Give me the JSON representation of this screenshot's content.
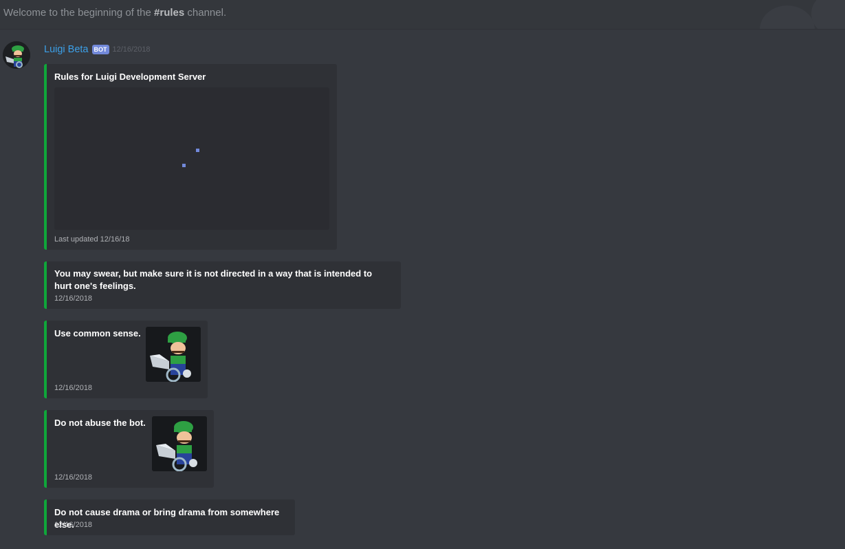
{
  "welcome": {
    "prefix": "Welcome to the beginning of the ",
    "channel": "#rules",
    "suffix": " channel."
  },
  "message": {
    "author": "Luigi Beta",
    "bot_tag": "BOT",
    "timestamp": "12/16/2018",
    "author_color": "#3ca0e8"
  },
  "embeds": [
    {
      "title": "Rules for Luigi Development Server",
      "footer": "Last updated 12/16/18",
      "image": "loading-image"
    },
    {
      "description": "You may swear, but make sure it is not directed in a way that is intended to hurt one's feelings.",
      "footer": "12/16/2018"
    },
    {
      "description": "Use common sense.",
      "footer": "12/16/2018",
      "thumbnail": "luigi-thumbnail"
    },
    {
      "description": "Do not abuse the bot.",
      "footer": "12/16/2018",
      "thumbnail": "luigi-thumbnail"
    },
    {
      "description": "Do not cause drama or bring drama from somewhere else.",
      "footer": "12/16/2018"
    }
  ],
  "colors": {
    "embed_border": "#0fa63a",
    "background": "#36393f",
    "embed_bg": "#2f3136",
    "bot_tag": "#7289da"
  }
}
